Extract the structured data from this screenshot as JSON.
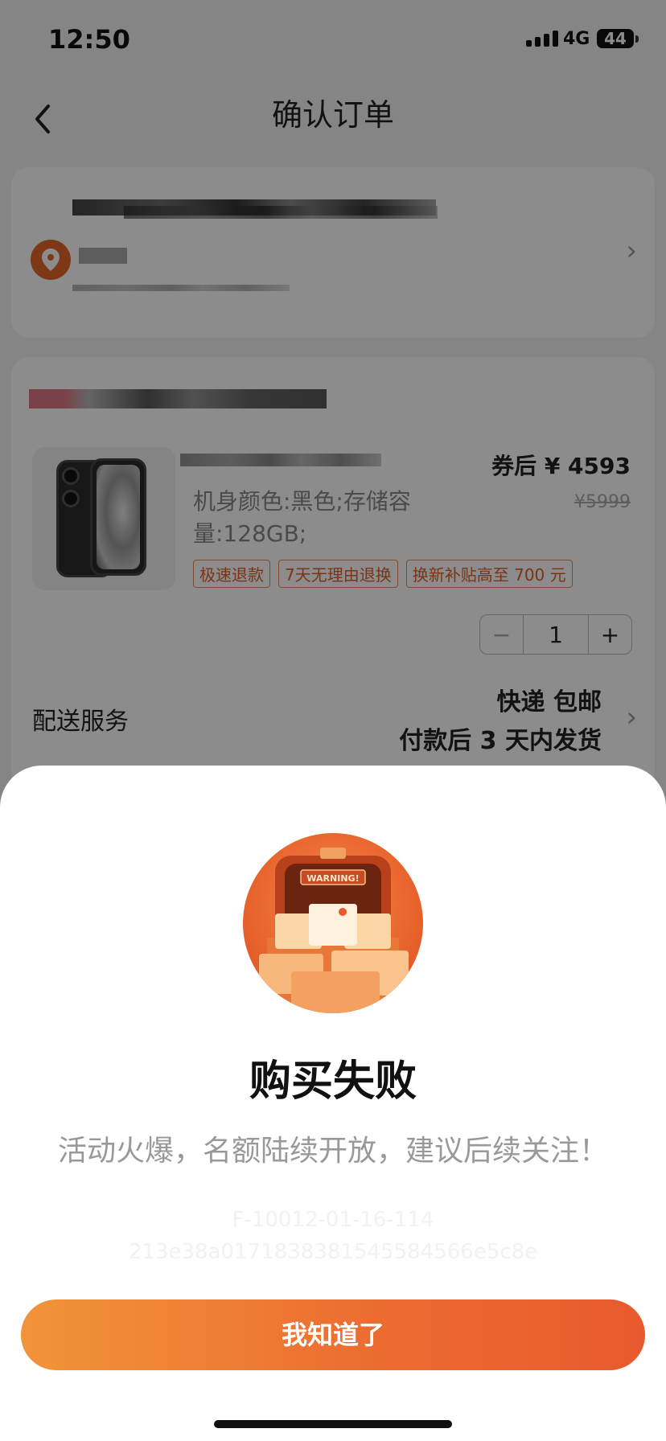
{
  "status_bar": {
    "time": "12:50",
    "network": "4G",
    "battery": "44"
  },
  "nav": {
    "title": "确认订单"
  },
  "product": {
    "price_after_coupon": "券后 ¥ 4593",
    "original_price": "¥5999",
    "spec": "机身颜色:黑色;存储容量:128GB;",
    "tags": [
      "极速退款",
      "7天无理由退换",
      "换新补贴高至 700 元"
    ],
    "quantity": "1",
    "minus": "−",
    "plus": "+"
  },
  "delivery": {
    "label": "配送服务",
    "line1": "快递 包邮",
    "line2": "付款后 3 天内发货"
  },
  "dialog": {
    "badge_text": "WARNING!",
    "title": "购买失败",
    "subtitle": "活动火爆，名额陆续开放，建议后续关注！",
    "code_line1": "F-10012-01-16-114",
    "code_line2": "213e38a0171838381545584566e5c8e",
    "button_label": "我知道了"
  },
  "colors": {
    "accent": "#EC6A30",
    "tag_border": "#E8865A"
  }
}
